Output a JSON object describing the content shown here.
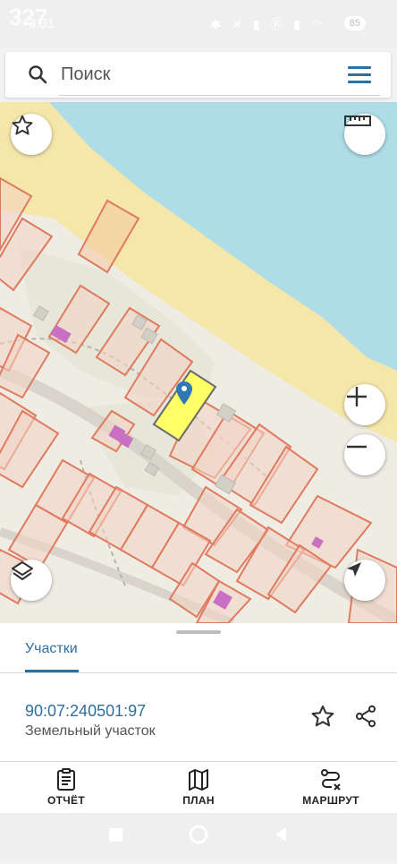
{
  "status_bar": {
    "overlay_number": "327",
    "time": "3:31",
    "battery": "85"
  },
  "search": {
    "placeholder": "Поиск"
  },
  "panel": {
    "tab_label": "Участки",
    "parcel_id": "90:07:240501:97",
    "parcel_type": "Земельный участок"
  },
  "bottom_nav": [
    {
      "label": "ОТЧЁТ",
      "icon": "report-icon"
    },
    {
      "label": "ПЛАН",
      "icon": "map-icon"
    },
    {
      "label": "МАРШРУТ",
      "icon": "route-icon"
    }
  ],
  "colors": {
    "accent": "#2e6f9e",
    "water": "#aedde7",
    "sand": "#f5e6a9",
    "parcel_stroke": "#e07a5f",
    "selected_parcel": "#ffff66"
  },
  "map_controls": [
    "favorite-star-icon",
    "ruler-icon",
    "zoom-in-icon",
    "zoom-out-icon",
    "layers-icon",
    "locate-arrow-icon"
  ]
}
